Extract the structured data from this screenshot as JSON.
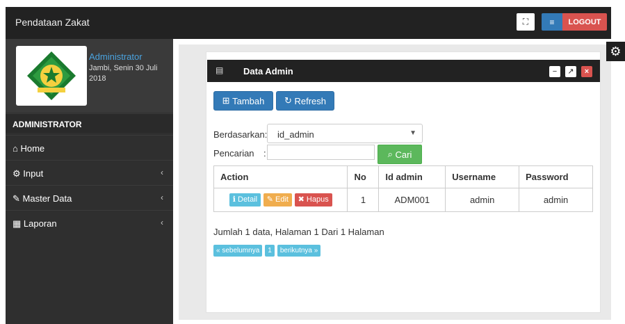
{
  "app": {
    "title": "Pendataan Zakat"
  },
  "header": {
    "fullscreen_icon": "expand-icon",
    "menu_icon": "bars-icon",
    "logout_label": "LOGOUT"
  },
  "profile": {
    "name": "Administrator",
    "date": "Jambi, Senin 30 Juli 2018"
  },
  "sidebar": {
    "section_title": "ADMINISTRATOR",
    "items": [
      {
        "label": "Home",
        "icon": "home-icon"
      },
      {
        "label": "Input",
        "icon": "cogs-icon"
      },
      {
        "label": "Master Data",
        "icon": "edit-icon"
      },
      {
        "label": "Laporan",
        "icon": "calendar-icon"
      }
    ]
  },
  "panel": {
    "title": "Data Admin",
    "buttons": {
      "tambah": "Tambah",
      "refresh": "Refresh"
    },
    "filter": {
      "by_label": "Berdasarkan:",
      "by_value": "id_admin",
      "search_label": "Pencarian",
      "search_sep": ":",
      "search_value": "",
      "cari_label": "Cari"
    }
  },
  "table": {
    "headers": [
      "Action",
      "No",
      "Id admin",
      "Username",
      "Password"
    ],
    "rows": [
      {
        "no": "1",
        "id_admin": "ADM001",
        "username": "admin",
        "password": "admin"
      }
    ],
    "actions": {
      "detail": "Detail",
      "edit": "Edit",
      "hapus": "Hapus"
    }
  },
  "summary": "Jumlah 1 data, Halaman 1 Dari 1 Halaman",
  "pager": {
    "prev": "« sebelumnya",
    "page": "1",
    "next": "berikutnya »"
  },
  "colors": {
    "topbar": "#222222",
    "sidebar": "#2f2f2f",
    "primary": "#337ab7",
    "danger": "#d9534f",
    "success": "#5cb85c",
    "info": "#5bc0de",
    "warning": "#f0ad4e"
  }
}
